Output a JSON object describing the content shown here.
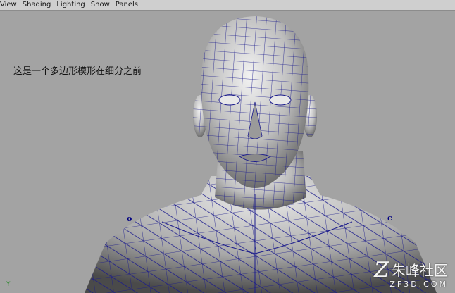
{
  "menubar": {
    "items": [
      "View",
      "Shading",
      "Lighting",
      "Show",
      "Panels"
    ]
  },
  "viewport": {
    "caption": "这是一个多边形模形在细分之前",
    "marker_left": "o",
    "marker_right": "c",
    "axis_label": "Y"
  },
  "watermark": {
    "cn": "朱峰社区",
    "en": "ZF3D.COM"
  },
  "colors": {
    "background": "#a3a3a3",
    "wireframe": "#1a1a8c",
    "menubar": "#cfcfcf"
  }
}
